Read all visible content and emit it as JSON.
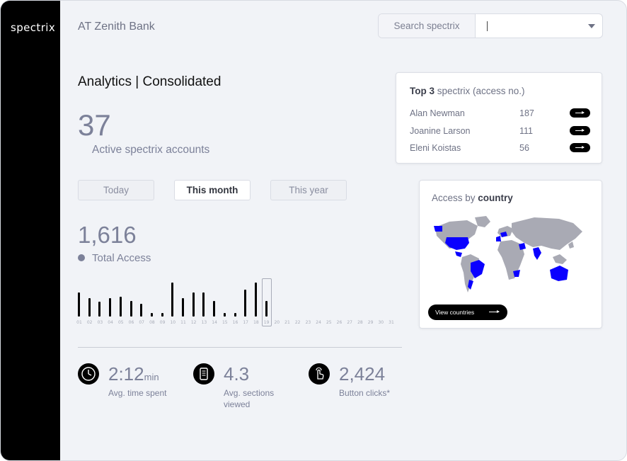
{
  "sidebar": {
    "brand": "spectrix"
  },
  "header": {
    "bank_name": "AT Zenith Bank",
    "search": {
      "label": "Search spectrix",
      "value": "|"
    }
  },
  "analytics": {
    "title": "Analytics | Consolidated",
    "active_accounts": {
      "value": "37",
      "label": "Active spectrix accounts"
    },
    "tabs": [
      {
        "label": "Today",
        "active": false
      },
      {
        "label": "This month",
        "active": true
      },
      {
        "label": "This year",
        "active": false
      }
    ],
    "total_access": {
      "value": "1,616",
      "label": "Total Access"
    }
  },
  "chart_data": {
    "type": "bar",
    "categories": [
      "01",
      "02",
      "03",
      "04",
      "05",
      "06",
      "07",
      "08",
      "09",
      "10",
      "11",
      "12",
      "13",
      "14",
      "15",
      "16",
      "17",
      "18",
      "19",
      "20",
      "21",
      "22",
      "23",
      "24",
      "25",
      "26",
      "27",
      "28",
      "29",
      "30",
      "31"
    ],
    "values": [
      32,
      24,
      20,
      24,
      26,
      21,
      17,
      5,
      5,
      45,
      24,
      32,
      32,
      21,
      5,
      5,
      36,
      45,
      21,
      0,
      0,
      0,
      0,
      0,
      0,
      0,
      0,
      0,
      0,
      0,
      0
    ],
    "highlighted_category": "19"
  },
  "stats": [
    {
      "icon": "clock-icon",
      "value": "2:12",
      "unit": "min",
      "label": "Avg. time spent"
    },
    {
      "icon": "document-icon",
      "value": "4.3",
      "unit": "",
      "label": "Avg. sections viewed"
    },
    {
      "icon": "pointer-icon",
      "value": "2,424",
      "unit": "",
      "label": "Button clicks*"
    }
  ],
  "top3": {
    "title_bold": "Top 3",
    "title_rest": " spectrix (access no.)",
    "rows": [
      {
        "name": "Alan Newman",
        "count": "187"
      },
      {
        "name": "Joanine Larson",
        "count": "111"
      },
      {
        "name": "Eleni Koistas",
        "count": "56"
      }
    ]
  },
  "map_card": {
    "title_plain": "Access by ",
    "title_bold": "country",
    "button_label": "View countries"
  },
  "colors": {
    "accent": "#0a00ff",
    "map_land": "#a9aab4",
    "primary_text": "#7c8199"
  }
}
